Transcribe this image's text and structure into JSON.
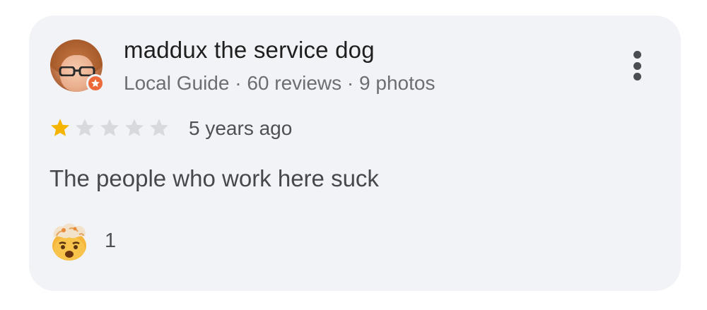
{
  "review": {
    "author": {
      "name": "maddux the service dog",
      "meta": "Local Guide · 60 reviews · 9 photos",
      "badge_icon": "local-guide-star-badge",
      "badge_color": "#ec6a3a"
    },
    "rating": {
      "value": 1,
      "max": 5,
      "filled_color": "#f4b400",
      "empty_color": "#d8d9dc"
    },
    "date": "5 years ago",
    "text": "The people who work here suck",
    "reaction": {
      "emoji_icon": "exploding-head-emoji-icon",
      "count": "1"
    },
    "menu_icon": "more-vert-icon"
  }
}
